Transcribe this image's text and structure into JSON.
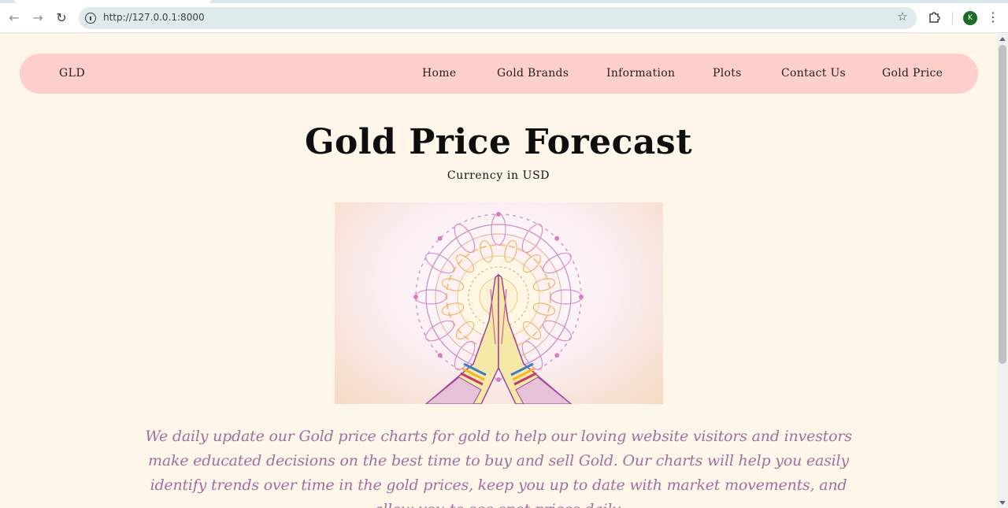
{
  "browser": {
    "url": "http://127.0.0.1:8000",
    "avatar_letter": "K"
  },
  "nav": {
    "brand": "GLD",
    "links": [
      "Home",
      "Gold Brands",
      "Information",
      "Plots",
      "Contact Us",
      "Gold Price"
    ]
  },
  "hero": {
    "title": "Gold Price Forecast",
    "subtitle": "Currency in USD",
    "image": "namaste-hands-mandala-illustration"
  },
  "description": "We daily update our Gold price charts for gold to help our loving website visitors and investors make educated decisions on the best time to buy and sell Gold. Our charts will help you easily identify trends over time in the gold prices, keep you up to date with market movements, and allow you to see spot prices daily.",
  "colors": {
    "page_bg": "#fef7e9",
    "navbar_bg": "#fecfcb",
    "description_text": "#a06fa0"
  }
}
